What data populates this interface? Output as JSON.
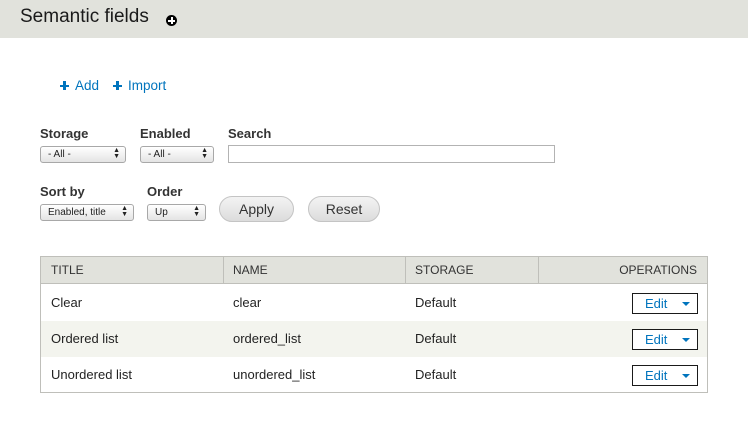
{
  "header": {
    "title": "Semantic fields",
    "shortcut_icon": "plus-circle-icon"
  },
  "actions": {
    "add": "Add",
    "import": "Import"
  },
  "filters": {
    "storage": {
      "label": "Storage",
      "value": "- All -"
    },
    "enabled": {
      "label": "Enabled",
      "value": "- All -"
    },
    "search": {
      "label": "Search",
      "value": ""
    },
    "sort_by": {
      "label": "Sort by",
      "value": "Enabled, title"
    },
    "order": {
      "label": "Order",
      "value": "Up"
    },
    "apply": "Apply",
    "reset": "Reset"
  },
  "table": {
    "columns": [
      "TITLE",
      "NAME",
      "STORAGE",
      "OPERATIONS"
    ],
    "rows": [
      {
        "title": "Clear",
        "name": "clear",
        "storage": "Default",
        "operation": "Edit"
      },
      {
        "title": "Ordered list",
        "name": "ordered_list",
        "storage": "Default",
        "operation": "Edit"
      },
      {
        "title": "Unordered list",
        "name": "unordered_list",
        "storage": "Default",
        "operation": "Edit"
      }
    ]
  },
  "colors": {
    "link": "#0074bd",
    "header_bg": "#e1e2dc",
    "row_alt": "#f3f4ee"
  }
}
